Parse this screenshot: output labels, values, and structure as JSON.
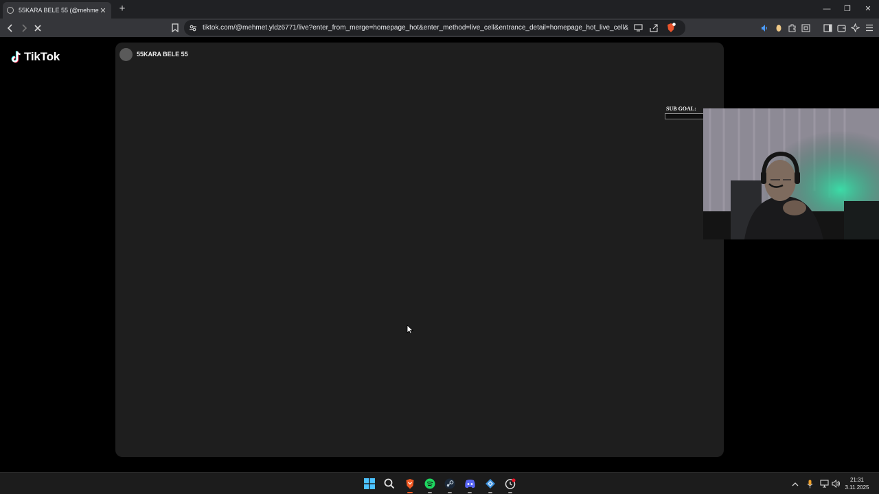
{
  "browser": {
    "tab_title": "55KARA BELE 55 (@mehmet.yld",
    "tab_close": "✕",
    "new_tab": "+",
    "url": "tiktok.com/@mehmet.yldz6771/live?enter_from_merge=homepage_hot&enter_method=live_cell&entrance_detail=homepage_hot_live_cell&from_pl...",
    "window_controls": {
      "minimize": "—",
      "maximize": "❐",
      "close": "✕"
    }
  },
  "page": {
    "logo_text": "TikTok",
    "host_name": "55KARA BELE 55",
    "sub_goal_label": "SUB GOAL:"
  },
  "taskbar": {
    "apps": [
      "start-icon",
      "search-icon",
      "brave-icon",
      "spotify-icon",
      "steam-icon",
      "discord-icon",
      "app-icon",
      "app-clock-icon"
    ],
    "time": "21:31",
    "date": "3.11.2025"
  }
}
